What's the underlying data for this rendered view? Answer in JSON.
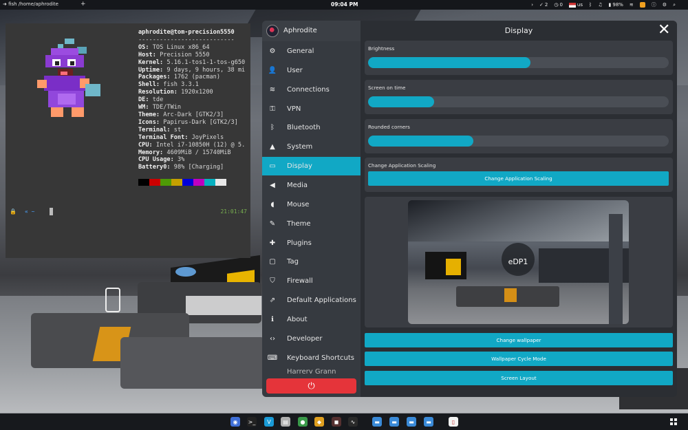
{
  "top_panel": {
    "window_title": "➜ fish /home/aphrodite",
    "new_tab_label": "+",
    "clock": "09:04 PM",
    "tray": {
      "check_count": "2",
      "clock_badge_count": "0",
      "keyboard_layout": "us",
      "battery_percent": "98%"
    }
  },
  "terminal": {
    "user_host": "aphrodite@tom-precision5550",
    "separator": "---------------------------",
    "info": [
      {
        "key": "OS",
        "value": "TOS Linux x86_64"
      },
      {
        "key": "Host",
        "value": "Precision 5550"
      },
      {
        "key": "Kernel",
        "value": "5.16.1-tos1-1-tos-g650"
      },
      {
        "key": "Uptime",
        "value": "9 days, 9 hours, 38 mi"
      },
      {
        "key": "Packages",
        "value": "1762 (pacman)"
      },
      {
        "key": "Shell",
        "value": "fish 3.3.1"
      },
      {
        "key": "Resolution",
        "value": "1920x1200"
      },
      {
        "key": "DE",
        "value": "tde"
      },
      {
        "key": "WM",
        "value": "TDE/TWin"
      },
      {
        "key": "Theme",
        "value": "Arc-Dark [GTK2/3]"
      },
      {
        "key": "Icons",
        "value": "Papirus-Dark [GTK2/3]"
      },
      {
        "key": "Terminal",
        "value": "st"
      },
      {
        "key": "Terminal Font",
        "value": "JoyPixels"
      },
      {
        "key": "CPU",
        "value": "Intel i7-10850H (12) @ 5."
      },
      {
        "key": "Memory",
        "value": "4609MiB / 15740MiB"
      },
      {
        "key": "CPU Usage",
        "value": "3%"
      },
      {
        "key": "Battery0",
        "value": "98% [Charging]"
      }
    ],
    "palette_colors": [
      "#000000",
      "#cc0000",
      "#4e9a06",
      "#c4a000",
      "#0000d8",
      "#c000c0",
      "#06b0c0",
      "#e8e8e8"
    ],
    "prompt_dir": "« ~",
    "prompt_time": "21:01:47"
  },
  "sidebar": {
    "user_name": "Aphrodite",
    "items": [
      {
        "label": "General",
        "icon": "gear-icon",
        "glyph": "⚙"
      },
      {
        "label": "User",
        "icon": "user-icon",
        "glyph": "👤"
      },
      {
        "label": "Connections",
        "icon": "wifi-icon",
        "glyph": "≋"
      },
      {
        "label": "VPN",
        "icon": "key-icon",
        "glyph": "⚿"
      },
      {
        "label": "Bluetooth",
        "icon": "bluetooth-icon",
        "glyph": "ᛒ"
      },
      {
        "label": "System",
        "icon": "chart-icon",
        "glyph": "▲"
      },
      {
        "label": "Display",
        "icon": "monitor-icon",
        "glyph": "▭"
      },
      {
        "label": "Media",
        "icon": "speaker-icon",
        "glyph": "◀"
      },
      {
        "label": "Mouse",
        "icon": "mouse-icon",
        "glyph": "◖"
      },
      {
        "label": "Theme",
        "icon": "brush-icon",
        "glyph": "✎"
      },
      {
        "label": "Plugins",
        "icon": "puzzle-icon",
        "glyph": "✚"
      },
      {
        "label": "Tag",
        "icon": "tag-icon",
        "glyph": "▢"
      },
      {
        "label": "Firewall",
        "icon": "shield-icon",
        "glyph": "⛉"
      },
      {
        "label": "Default Applications",
        "icon": "open-external-icon",
        "glyph": "⇗"
      },
      {
        "label": "About",
        "icon": "info-icon",
        "glyph": "ℹ"
      },
      {
        "label": "Developer",
        "icon": "code-icon",
        "glyph": "‹›"
      },
      {
        "label": "Keyboard Shortcuts",
        "icon": "keyboard-icon",
        "glyph": "⌨"
      }
    ],
    "active_item": "Display",
    "partial_item": "Harrery Grann",
    "power_glyph": "⏻"
  },
  "display_panel": {
    "title": "Display",
    "close_glyph": "✕",
    "brightness": {
      "label": "Brightness",
      "value": 0.54
    },
    "screen_on_time": {
      "label": "Screen on time",
      "value": 0.22
    },
    "rounded_corners": {
      "label": "Rounded corners",
      "value": 0.35
    },
    "scaling": {
      "label": "Change Application Scaling",
      "button_label": "Change Application Scaling"
    },
    "monitor_label": "eDP1",
    "buttons": {
      "change_wallpaper": "Change wallpaper",
      "wallpaper_cycle": "Wallpaper Cycle Mode",
      "screen_layout": "Screen Layout"
    }
  },
  "taskbar": {
    "apps": [
      {
        "name": "browser-icon",
        "color": "#3f6fd8",
        "glyph": "◉"
      },
      {
        "name": "terminal-icon",
        "color": "#222222",
        "glyph": ">_"
      },
      {
        "name": "vscode-icon",
        "color": "#1a9bd7",
        "glyph": "V"
      },
      {
        "name": "files-icon",
        "color": "#b0b0b0",
        "glyph": "▤"
      },
      {
        "name": "app-green-icon",
        "color": "#3a9a4a",
        "glyph": "●"
      },
      {
        "name": "game-icon",
        "color": "#e0a020",
        "glyph": "◆"
      },
      {
        "name": "app-red-icon",
        "color": "#553030",
        "glyph": "◼"
      },
      {
        "name": "monitor-app-icon",
        "color": "#2a2a2a",
        "glyph": "∿"
      },
      {
        "name": "folder-icon-1",
        "color": "#3a8ad8",
        "glyph": "▬"
      },
      {
        "name": "folder-icon-2",
        "color": "#3a8ad8",
        "glyph": "▬"
      },
      {
        "name": "folder-icon-3",
        "color": "#3a8ad8",
        "glyph": "▬"
      },
      {
        "name": "folder-icon-4",
        "color": "#3a8ad8",
        "glyph": "▬"
      },
      {
        "name": "document-icon",
        "color": "#f2f2f2",
        "glyph": "▯"
      }
    ]
  }
}
